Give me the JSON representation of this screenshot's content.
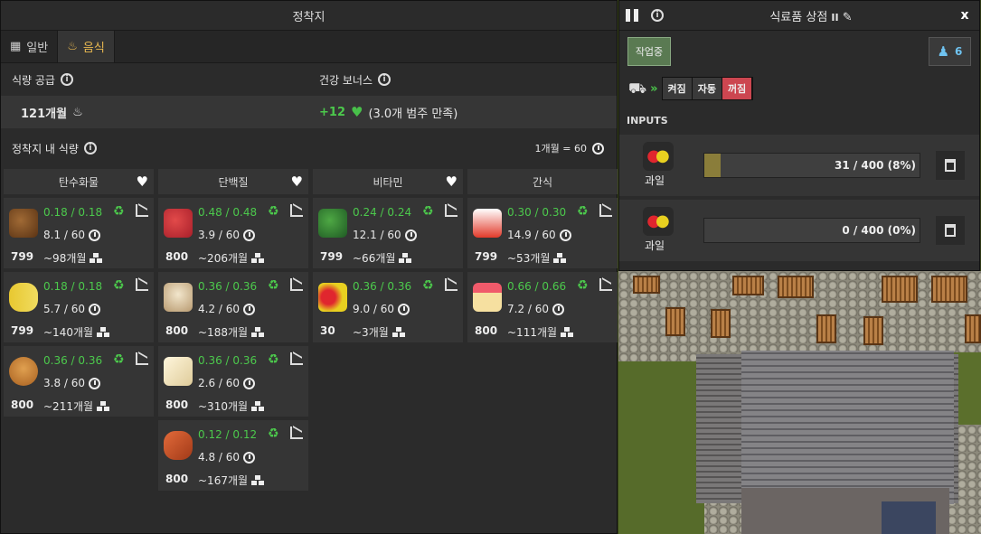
{
  "settlement": {
    "title": "정착지",
    "tabs": [
      {
        "label": "일반",
        "icon": "warehouse-icon"
      },
      {
        "label": "음식",
        "icon": "food-bowl-icon",
        "active": true
      }
    ],
    "food_supply_label": "식량 공급",
    "food_supply_value": "121개월",
    "health_bonus_label": "건강 보너스",
    "health_bonus_value": "+12",
    "health_bonus_detail": "(3.0개 범주 만족)",
    "food_in_settlement_label": "정착지 내 식량",
    "ratio_label": "1개월 = 60",
    "categories": [
      {
        "name": "탄수화물",
        "health": true,
        "items": [
          {
            "icon": "potato-icon",
            "rate": "0.18 / 0.18",
            "cons": "8.1 / 60",
            "count": "799",
            "months": "~98개월"
          },
          {
            "icon": "corn-icon",
            "rate": "0.18 / 0.18",
            "cons": "5.7 / 60",
            "count": "799",
            "months": "~140개월"
          },
          {
            "icon": "bread-icon",
            "rate": "0.36 / 0.36",
            "cons": "3.8 / 60",
            "count": "800",
            "months": "~211개월"
          }
        ]
      },
      {
        "name": "단백질",
        "health": true,
        "items": [
          {
            "icon": "meat-icon",
            "rate": "0.48 / 0.48",
            "cons": "3.9 / 60",
            "count": "800",
            "months": "~206개월"
          },
          {
            "icon": "eggs-icon",
            "rate": "0.36 / 0.36",
            "cons": "4.2 / 60",
            "count": "800",
            "months": "~188개월"
          },
          {
            "icon": "tofu-icon",
            "rate": "0.36 / 0.36",
            "cons": "2.6 / 60",
            "count": "800",
            "months": "~310개월"
          },
          {
            "icon": "sausage-icon",
            "rate": "0.12 / 0.12",
            "cons": "4.8 / 60",
            "count": "800",
            "months": "~167개월"
          }
        ]
      },
      {
        "name": "비타민",
        "health": true,
        "items": [
          {
            "icon": "vegetables-icon",
            "rate": "0.24 / 0.24",
            "cons": "12.1 / 60",
            "count": "799",
            "months": "~66개월"
          },
          {
            "icon": "fruit-icon",
            "rate": "0.36 / 0.36",
            "cons": "9.0 / 60",
            "count": "30",
            "months": "~3개월"
          }
        ]
      },
      {
        "name": "간식",
        "health": false,
        "items": [
          {
            "icon": "snack-bag-icon",
            "rate": "0.30 / 0.30",
            "cons": "14.9 / 60",
            "count": "799",
            "months": "~53개월"
          },
          {
            "icon": "cake-icon",
            "rate": "0.66 / 0.66",
            "cons": "7.2 / 60",
            "count": "800",
            "months": "~111개월"
          }
        ]
      }
    ]
  },
  "store": {
    "title": "식료품 상점",
    "title_suffix": "II",
    "status": "작업중",
    "workers": "6",
    "modes": [
      "켜짐",
      "자동",
      "꺼짐"
    ],
    "inputs_label": "INPUTS",
    "slots": [
      {
        "label": "과일",
        "icon": "fruit-icon",
        "text": "31 / 400 (8%)",
        "fill": 0.0775
      },
      {
        "label": "과일",
        "icon": "fruit-icon",
        "text": "0 / 400 (0%)",
        "fill": 0
      }
    ],
    "close": "x"
  }
}
